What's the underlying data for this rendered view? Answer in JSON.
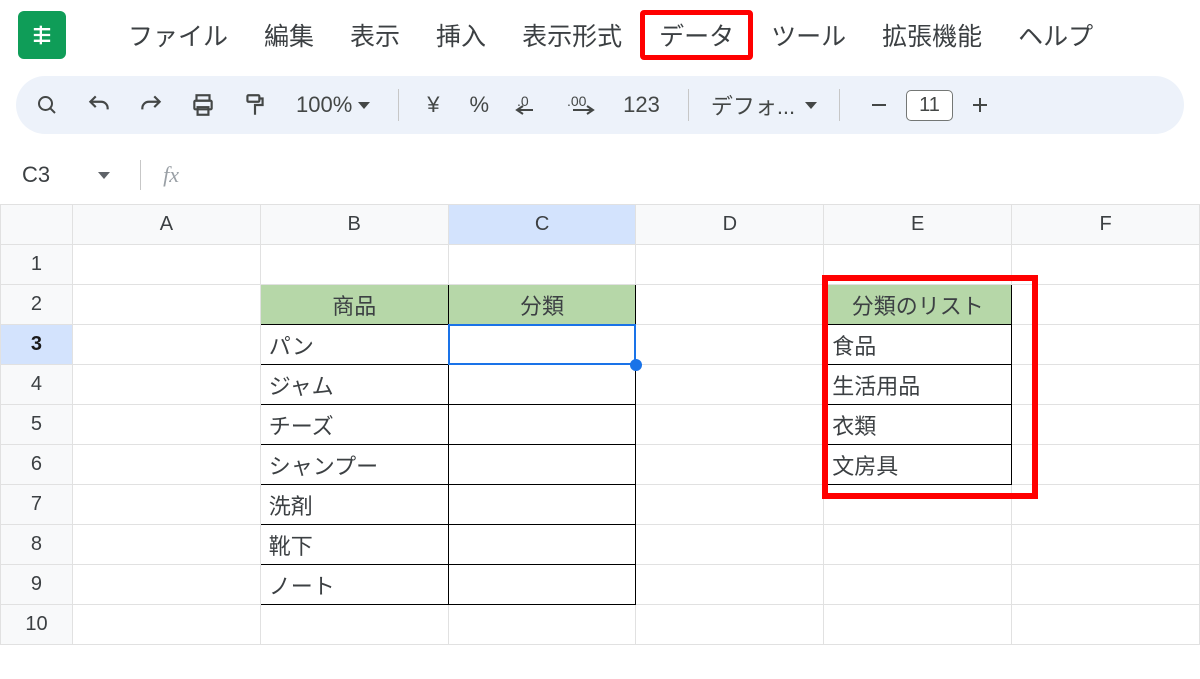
{
  "menu": {
    "items": [
      "ファイル",
      "編集",
      "表示",
      "挿入",
      "表示形式",
      "データ",
      "ツール",
      "拡張機能",
      "ヘルプ"
    ],
    "highlighted_index": 5
  },
  "toolbar": {
    "zoom": "100%",
    "currency": "¥",
    "percent": "%",
    "dec_decrease": ".0",
    "dec_increase": ".00",
    "number_format": "123",
    "font_name": "デフォ...",
    "font_size": "11"
  },
  "namebox": {
    "ref": "C3"
  },
  "formula_bar": {
    "label": "fx",
    "value": ""
  },
  "columns": [
    "A",
    "B",
    "C",
    "D",
    "E",
    "F"
  ],
  "active_column_index": 2,
  "rows": [
    1,
    2,
    3,
    4,
    5,
    6,
    7,
    8,
    9,
    10
  ],
  "active_row_index": 2,
  "sheet": {
    "B2": "商品",
    "C2": "分類",
    "B3": "パン",
    "B4": "ジャム",
    "B5": "チーズ",
    "B6": "シャンプー",
    "B7": "洗剤",
    "B8": "靴下",
    "B9": "ノート",
    "E2": "分類のリスト",
    "E3": "食品",
    "E4": "生活用品",
    "E5": "衣類",
    "E6": "文房具"
  },
  "selected_cell": "C3"
}
